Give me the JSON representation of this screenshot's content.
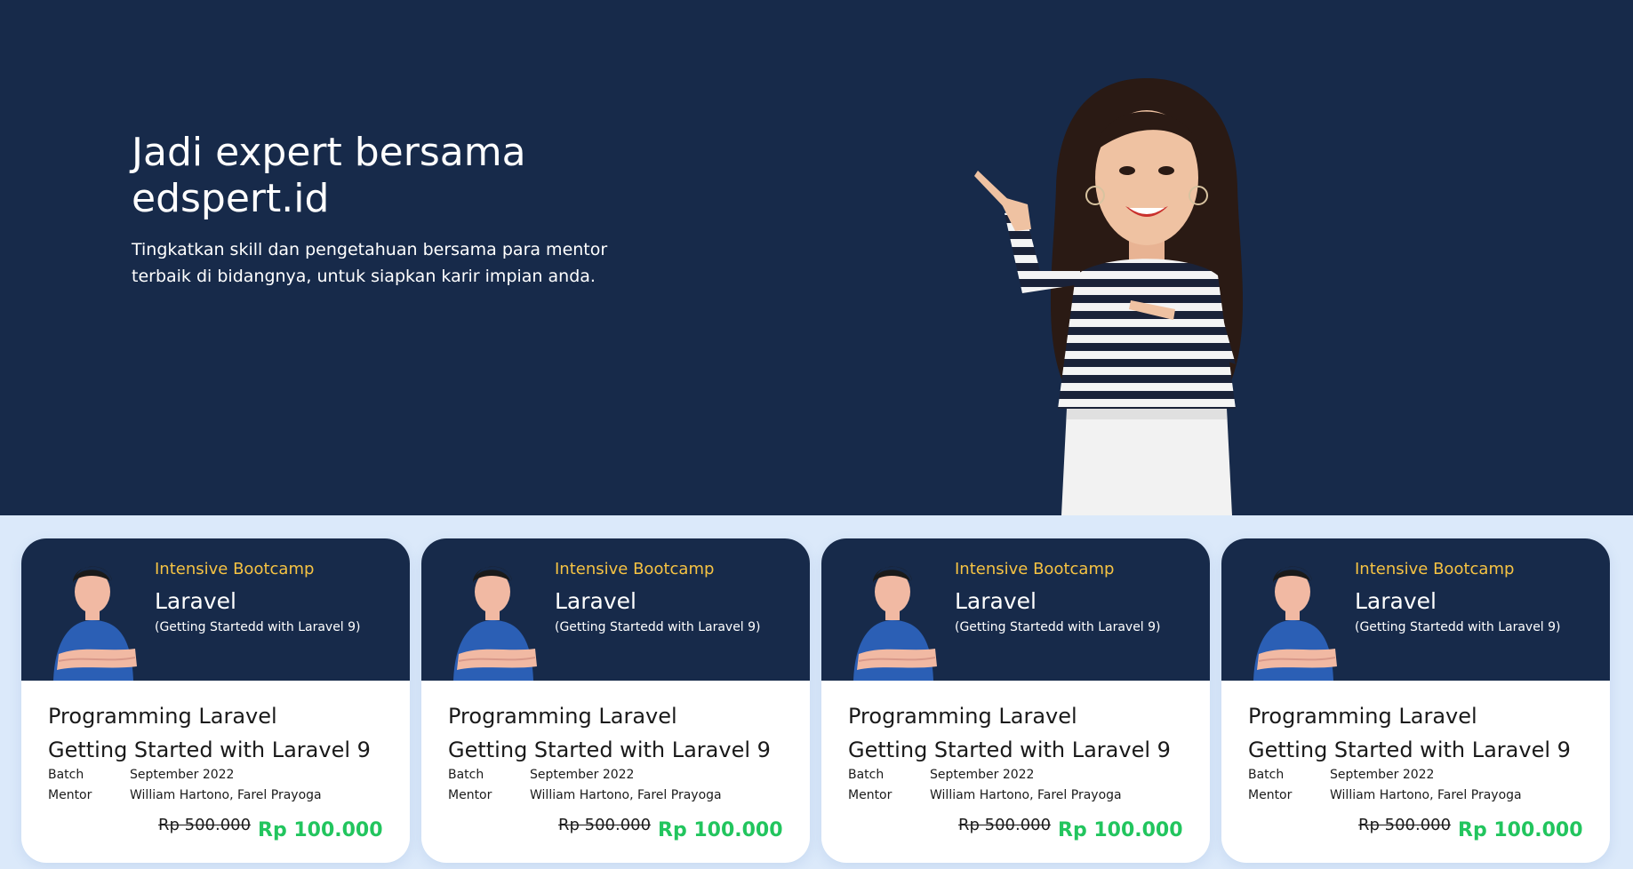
{
  "hero": {
    "title": "Jadi expert bersama edspert.id",
    "subtitle": "Tingkatkan skill dan pengetahuan bersama para mentor terbaik di bidangnya, untuk siapkan karir impian anda."
  },
  "colors": {
    "navy": "#172a4a",
    "accent_yellow": "#f6c343",
    "price_green": "#22c55e",
    "page_bg": "#dbe9fa"
  },
  "cards": [
    {
      "eyebrow": "Intensive Bootcamp",
      "course": "Laravel",
      "course_sub": "(Getting Startedd with Laravel 9)",
      "title_line1": "Programming Laravel",
      "title_line2": "Getting Started with Laravel 9",
      "batch_label": "Batch",
      "batch_value": "September 2022",
      "mentor_label": "Mentor",
      "mentor_value": "William Hartono, Farel Prayoga",
      "price_old": "Rp 500.000",
      "price_new": "Rp 100.000"
    },
    {
      "eyebrow": "Intensive Bootcamp",
      "course": "Laravel",
      "course_sub": "(Getting Startedd with Laravel 9)",
      "title_line1": "Programming Laravel",
      "title_line2": "Getting Started with Laravel 9",
      "batch_label": "Batch",
      "batch_value": "September 2022",
      "mentor_label": "Mentor",
      "mentor_value": "William Hartono, Farel Prayoga",
      "price_old": "Rp 500.000",
      "price_new": "Rp 100.000"
    },
    {
      "eyebrow": "Intensive Bootcamp",
      "course": "Laravel",
      "course_sub": "(Getting Startedd with Laravel 9)",
      "title_line1": "Programming Laravel",
      "title_line2": "Getting Started with Laravel 9",
      "batch_label": "Batch",
      "batch_value": "September 2022",
      "mentor_label": "Mentor",
      "mentor_value": "William Hartono, Farel Prayoga",
      "price_old": "Rp 500.000",
      "price_new": "Rp 100.000"
    },
    {
      "eyebrow": "Intensive Bootcamp",
      "course": "Laravel",
      "course_sub": "(Getting Startedd with Laravel 9)",
      "title_line1": "Programming Laravel",
      "title_line2": "Getting Started with Laravel 9",
      "batch_label": "Batch",
      "batch_value": "September 2022",
      "mentor_label": "Mentor",
      "mentor_value": "William Hartono, Farel Prayoga",
      "price_old": "Rp 500.000",
      "price_new": "Rp 100.000"
    }
  ]
}
